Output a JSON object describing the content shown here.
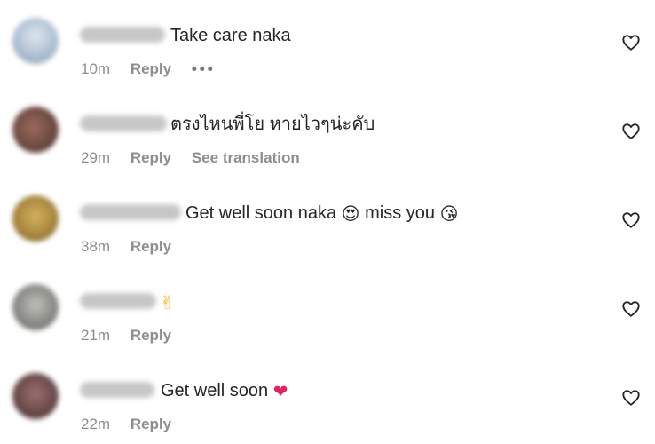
{
  "comments": [
    {
      "text": "Take care naka",
      "time": "10m",
      "reply_label": "Reply",
      "more_label": "•••",
      "emojis": [],
      "avatar_color": "#aebfd3"
    },
    {
      "text": "ตรงไหนพี่โย หายไวๆน่ะคับ",
      "time": "29m",
      "reply_label": "Reply",
      "translate_label": "See translation",
      "emojis": [],
      "avatar_color": "#6e4a42"
    },
    {
      "text": "Get well soon naka",
      "text2": "miss you",
      "time": "38m",
      "reply_label": "Reply",
      "emojis": [
        "😍",
        "😘"
      ],
      "avatar_color": "#a9863e"
    },
    {
      "text": "",
      "time": "21m",
      "reply_label": "Reply",
      "emojis": [
        "✌"
      ],
      "avatar_color": "#8a8a86"
    },
    {
      "text": "Get well soon",
      "time": "22m",
      "reply_label": "Reply",
      "emojis": [
        "❤"
      ],
      "avatar_color": "#6b4a4a"
    }
  ],
  "icons": {
    "like": "heart-outline-icon"
  },
  "colors": {
    "text": "#262626",
    "meta": "#8e8e8e",
    "heart_emoji": "#e0245e",
    "emoji_yellow": "#f7b52c"
  }
}
